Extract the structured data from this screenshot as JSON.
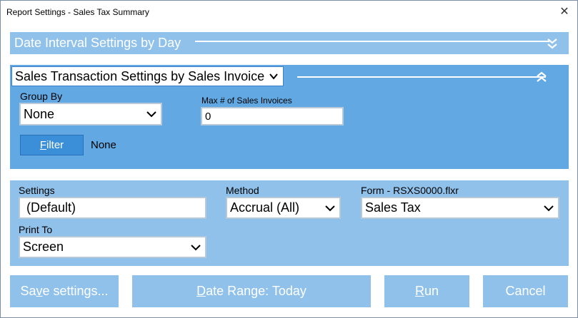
{
  "window": {
    "title": "Report Settings - Sales Tax Summary",
    "close_glyph": "✕"
  },
  "date_section": {
    "label": "Date Interval Settings by Day",
    "toggle_icon": "double-chevron-down-icon"
  },
  "sales_section": {
    "label": "Sales Transaction Settings by Sales Invoice",
    "toggle_icon": "double-chevron-up-icon",
    "group_by": {
      "label": "Group By",
      "value": "None"
    },
    "max_invoices": {
      "label": "Max # of Sales Invoices",
      "value": "0"
    },
    "filter": {
      "button_label_underlined": "F",
      "button_label_rest": "ilter",
      "value": "None"
    }
  },
  "settings_section": {
    "settings": {
      "label": "Settings",
      "value": " (Default)"
    },
    "method": {
      "label": "Method",
      "value": "Accrual (All)"
    },
    "form": {
      "label": "Form - RSXS0000.flxr",
      "value": "Sales Tax"
    },
    "print_to": {
      "label": "Print To",
      "value": "Screen"
    }
  },
  "buttons": {
    "save": {
      "pre": "Sa",
      "underlined": "v",
      "post": "e settings..."
    },
    "date_range": {
      "pre": "",
      "underlined": "D",
      "post": "ate Range: Today"
    },
    "run": {
      "pre": "",
      "underlined": "R",
      "post": "un"
    },
    "cancel": {
      "label": "Cancel"
    }
  },
  "colors": {
    "section_light": "#8fc1ea",
    "section_dark": "#62a9e3",
    "filter_button": "#3a8fd8"
  }
}
